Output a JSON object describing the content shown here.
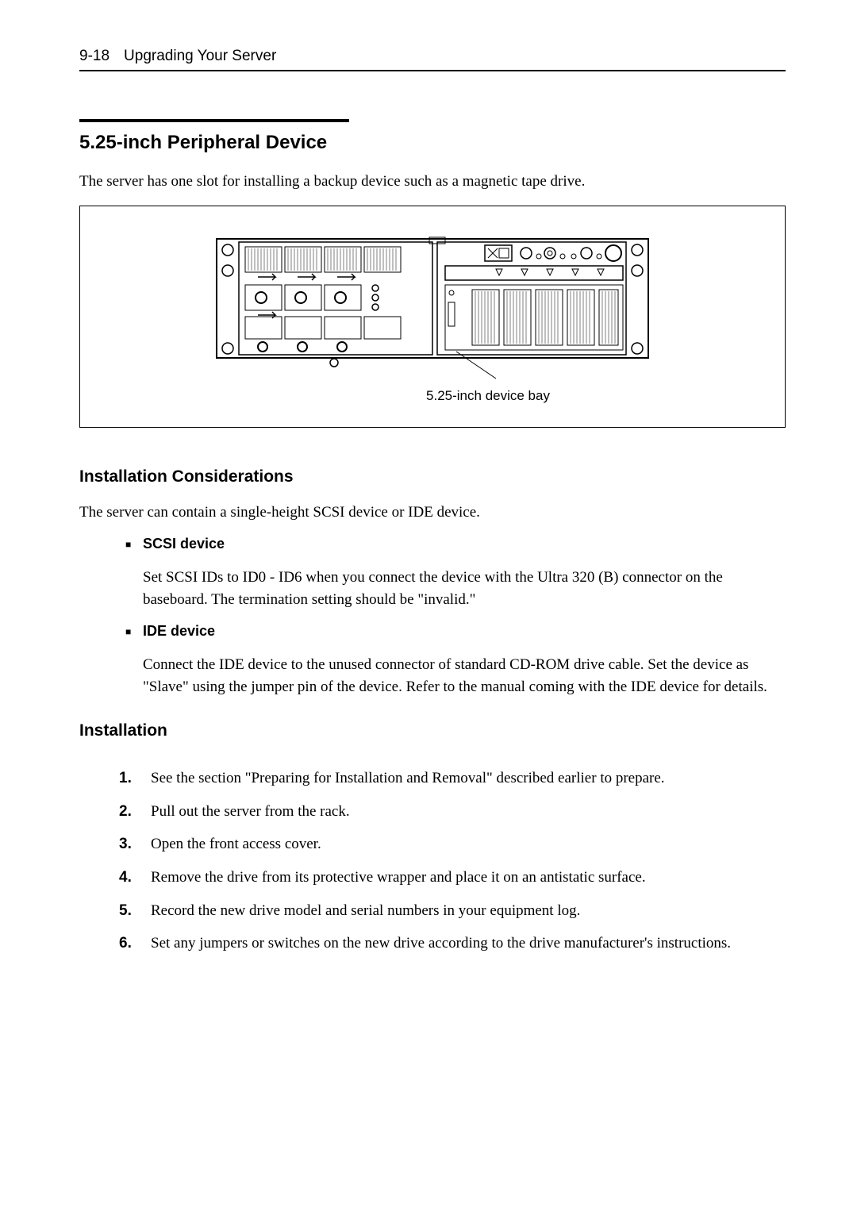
{
  "header": {
    "page_number": "9-18",
    "title": "Upgrading Your Server"
  },
  "section_heading": "5.25-inch Peripheral Device",
  "intro": "The server has one slot for installing a backup device such as a magnetic tape drive.",
  "diagram": {
    "callout": "5.25-inch device bay"
  },
  "considerations": {
    "heading": "Installation Considerations",
    "intro": "The server can contain a single-height SCSI device or IDE device.",
    "items": [
      {
        "title": "SCSI device",
        "desc": "Set SCSI IDs to ID0 - ID6 when you connect the device with the Ultra 320 (B) connector on the baseboard. The termination setting should be \"invalid.\""
      },
      {
        "title": "IDE device",
        "desc": "Connect the IDE device to the unused connector of standard CD-ROM drive cable. Set the device as \"Slave\" using the jumper pin of the device. Refer to the manual coming with the IDE device for details."
      }
    ]
  },
  "installation": {
    "heading": "Installation",
    "steps": [
      "See the section \"Preparing for Installation and Removal\" described earlier to prepare.",
      "Pull out the server from the rack.",
      "Open the front access cover.",
      "Remove the drive from its protective wrapper and place it on an antistatic surface.",
      "Record the new drive model and serial numbers in your equipment log.",
      "Set any jumpers or switches on the new drive according to the drive manufacturer's instructions."
    ]
  }
}
